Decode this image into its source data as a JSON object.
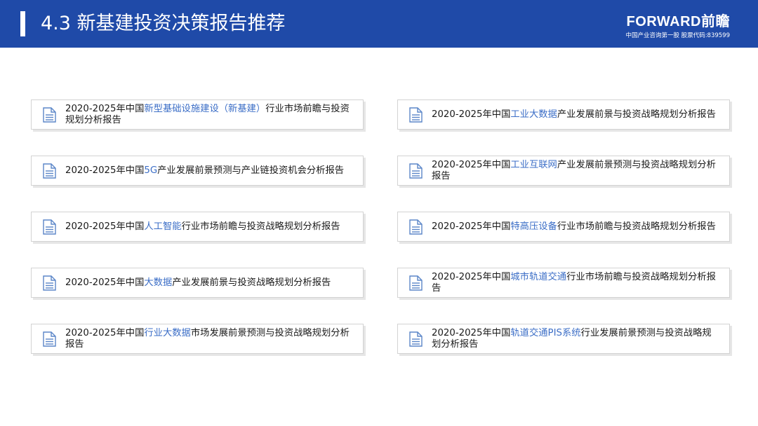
{
  "header": {
    "title": "4.3 新基建投资决策报告推荐",
    "brand": "FORWARD前瞻",
    "tagline": "中国产业咨询第一股  股票代码:839599"
  },
  "colors": {
    "header_bg": "#1f4aa8",
    "highlight": "#3d6fc7"
  },
  "reports": [
    {
      "prefix": "2020-2025年中国",
      "highlight": "新型基础设施建设（新基建）",
      "suffix": "行业市场前瞻与投资规划分析报告"
    },
    {
      "prefix": "2020-2025年中国",
      "highlight": "工业大数据",
      "suffix": "产业发展前景与投资战略规划分析报告"
    },
    {
      "prefix": "2020-2025年中国",
      "highlight": "5G",
      "suffix": "产业发展前景预测与产业链投资机会分析报告"
    },
    {
      "prefix": "2020-2025年中国",
      "highlight": "工业互联网",
      "suffix": "产业发展前景预测与投资战略规划分析报告"
    },
    {
      "prefix": "2020-2025年中国",
      "highlight": "人工智能",
      "suffix": "行业市场前瞻与投资战略规划分析报告"
    },
    {
      "prefix": "2020-2025年中国",
      "highlight": "特高压设备",
      "suffix": "行业市场前瞻与投资战略规划分析报告"
    },
    {
      "prefix": "2020-2025年中国",
      "highlight": "大数据",
      "suffix": "产业发展前景与投资战略规划分析报告"
    },
    {
      "prefix": "2020-2025年中国",
      "highlight": "城市轨道交通",
      "suffix": "行业市场前瞻与投资战略规划分析报告"
    },
    {
      "prefix": "2020-2025年中国",
      "highlight": "行业大数据",
      "suffix": "市场发展前景预测与投资战略规划分析报告"
    },
    {
      "prefix": "2020-2025年中国",
      "highlight": "轨道交通PIS系统",
      "suffix": "行业发展前景预测与投资战略规划分析报告"
    }
  ]
}
